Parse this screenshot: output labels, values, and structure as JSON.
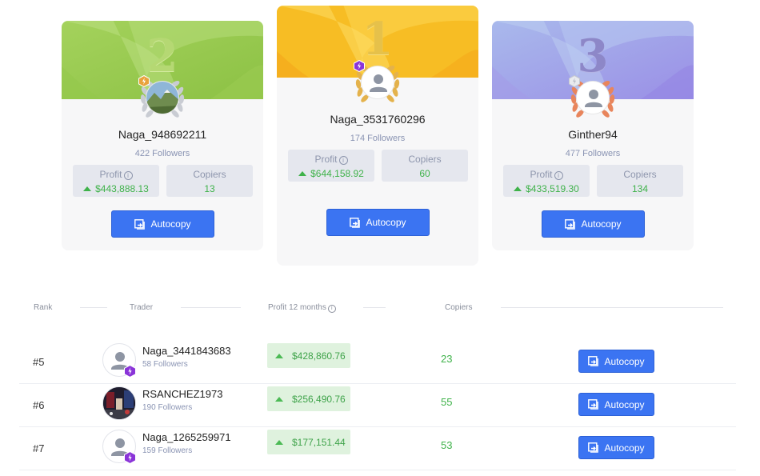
{
  "podium": [
    {
      "rank": "2",
      "name": "Naga_948692211",
      "followers": "422 Followers",
      "profit_label": "Profit",
      "profit": "$443,888.13",
      "copiers_label": "Copiers",
      "copiers": "13",
      "button": "Autocopy",
      "colors": {
        "header_a": "#9fcf55",
        "header_b": "#bfe07e",
        "number": "#b5d873",
        "laurel": "#c9ccd3",
        "badge": "#e9a23b"
      }
    },
    {
      "rank": "1",
      "name": "Naga_3531760296",
      "followers": "174 Followers",
      "profit_label": "Profit",
      "profit": "$644,158.92",
      "copiers_label": "Copiers",
      "copiers": "60",
      "button": "Autocopy",
      "colors": {
        "header_a": "#f6b81f",
        "header_b": "#fcd652",
        "number": "#e6c14a",
        "laurel": "#e4b24c",
        "badge": "#8a34d8"
      }
    },
    {
      "rank": "3",
      "name": "Ginther94",
      "followers": "477 Followers",
      "profit_label": "Profit",
      "profit": "$433,519.30",
      "copiers_label": "Copiers",
      "copiers": "134",
      "button": "Autocopy",
      "colors": {
        "header_a": "#9b8fea",
        "header_b": "#b6c7ee",
        "number": "#8d87c8",
        "laurel": "#e8855c",
        "badge": "#c5c8cf"
      }
    }
  ],
  "table": {
    "headers": {
      "rank": "Rank",
      "trader": "Trader",
      "profit": "Profit 12 months",
      "copiers": "Copiers"
    },
    "rows": [
      {
        "rank": "#5",
        "name": "Naga_3441843683",
        "followers": "58 Followers",
        "profit": "$428,860.76",
        "copiers": "23",
        "button": "Autocopy",
        "avatar": "default"
      },
      {
        "rank": "#6",
        "name": "RSANCHEZ1973",
        "followers": "190 Followers",
        "profit": "$256,490.76",
        "copiers": "55",
        "button": "Autocopy",
        "avatar": "photo"
      },
      {
        "rank": "#7",
        "name": "Naga_1265259971",
        "followers": "159 Followers",
        "profit": "$177,151.44",
        "copiers": "53",
        "button": "Autocopy",
        "avatar": "default"
      }
    ]
  },
  "icons": {
    "autocopy": "autocopy-icon",
    "info": "info-icon",
    "up": "trend-up-icon",
    "badge": "hexagon-lightning-icon",
    "avatar": "user-avatar-icon",
    "laurel": "laurel-wreath-icon"
  },
  "colors": {
    "accent": "#3b74f2",
    "profit_green": "#3fb24a",
    "profit_bg": "#dff2de",
    "badge_purple": "#8a34d8"
  }
}
